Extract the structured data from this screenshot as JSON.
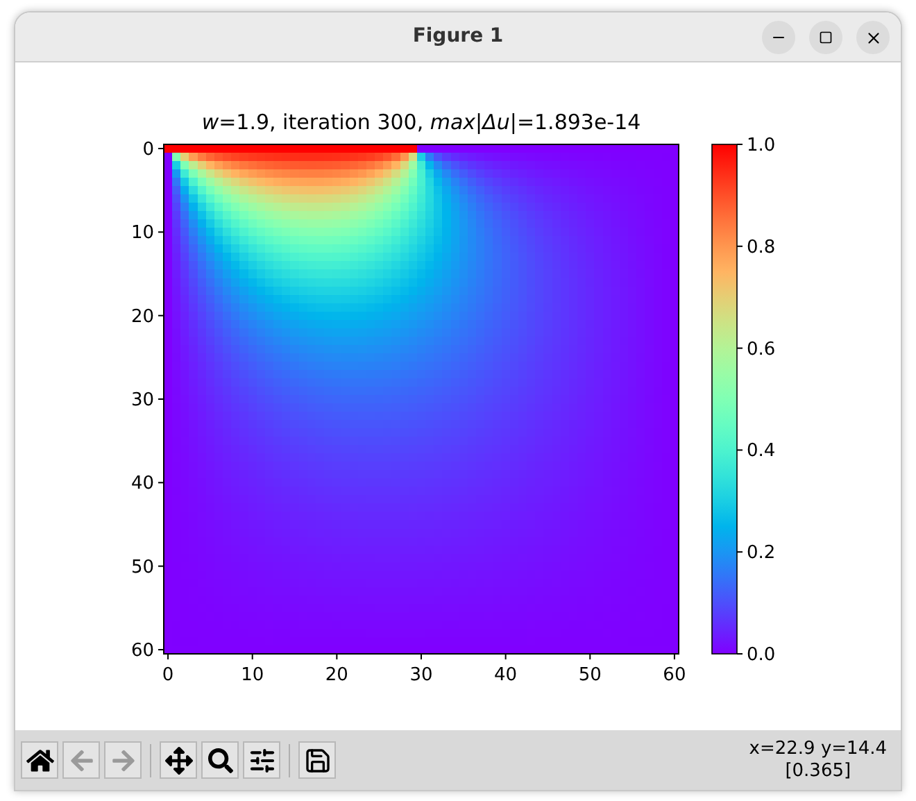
{
  "window": {
    "title": "Figure 1"
  },
  "plot": {
    "title": "*w*=1.9, iteration 300, *max*|*Δu*|=1.893e-14",
    "x_tick_labels": [
      "0",
      "10",
      "20",
      "30",
      "40",
      "50",
      "60"
    ],
    "y_tick_labels": [
      "0",
      "10",
      "20",
      "30",
      "40",
      "50",
      "60"
    ],
    "colorbar_tick_labels": [
      "1.0",
      "0.8",
      "0.6",
      "0.4",
      "0.2",
      "0.0"
    ]
  },
  "toolbar": {
    "buttons": [
      {
        "kind": "home",
        "disabled": false
      },
      {
        "kind": "back",
        "disabled": true
      },
      {
        "kind": "forward",
        "disabled": true
      },
      {
        "kind": "pan",
        "disabled": false
      },
      {
        "kind": "zoom",
        "disabled": false
      },
      {
        "kind": "configure",
        "disabled": false
      },
      {
        "kind": "save",
        "disabled": false
      }
    ]
  },
  "status": {
    "coordinates": "x=22.9 y=14.4",
    "value": "[0.365]"
  }
}
